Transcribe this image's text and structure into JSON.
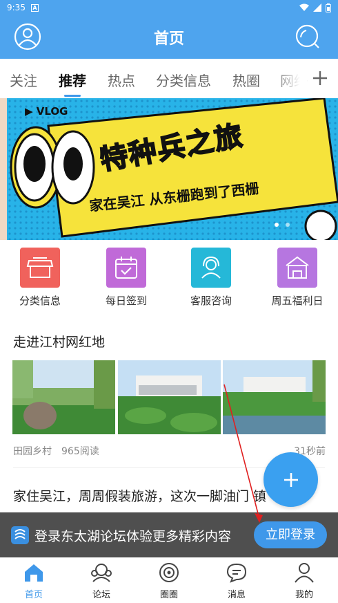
{
  "status_bar": {
    "time": "9:35",
    "badge": "A"
  },
  "header": {
    "title": "首页"
  },
  "tabs": [
    {
      "label": "关注"
    },
    {
      "label": "推荐"
    },
    {
      "label": "热点"
    },
    {
      "label": "分类信息"
    },
    {
      "label": "热圈"
    },
    {
      "label": "网络"
    }
  ],
  "banner": {
    "tag": "VLOG",
    "title": "特种兵之旅",
    "subtitle": "家在吴江 从东栅跑到了西栅"
  },
  "quick_links": [
    {
      "label": "分类信息",
      "icon": "shop-icon",
      "color": "#f0625c"
    },
    {
      "label": "每日签到",
      "icon": "calendar-check-icon",
      "color": "#c06ad8"
    },
    {
      "label": "客服咨询",
      "icon": "headset-icon",
      "color": "#25b8d8"
    },
    {
      "label": "周五福利日",
      "icon": "gift-house-icon",
      "color": "#b676e0"
    }
  ],
  "article1": {
    "title": "走进江村网红地",
    "source": "田园乡村",
    "reads": "965阅读",
    "time": "31秒前"
  },
  "article2": {
    "title": "家住吴江，周周假装旅游，这次一脚油门 镇"
  },
  "login_bar": {
    "text": "登录东太湖论坛体验更多精彩内容",
    "button": "立即登录"
  },
  "tabbar": [
    {
      "label": "首页",
      "icon": "home-icon"
    },
    {
      "label": "论坛",
      "icon": "forum-icon"
    },
    {
      "label": "圈圈",
      "icon": "circle-icon"
    },
    {
      "label": "消息",
      "icon": "message-icon"
    },
    {
      "label": "我的",
      "icon": "profile-icon"
    }
  ],
  "colors": {
    "primary": "#4ea4ee",
    "accent": "#3f98ea"
  }
}
